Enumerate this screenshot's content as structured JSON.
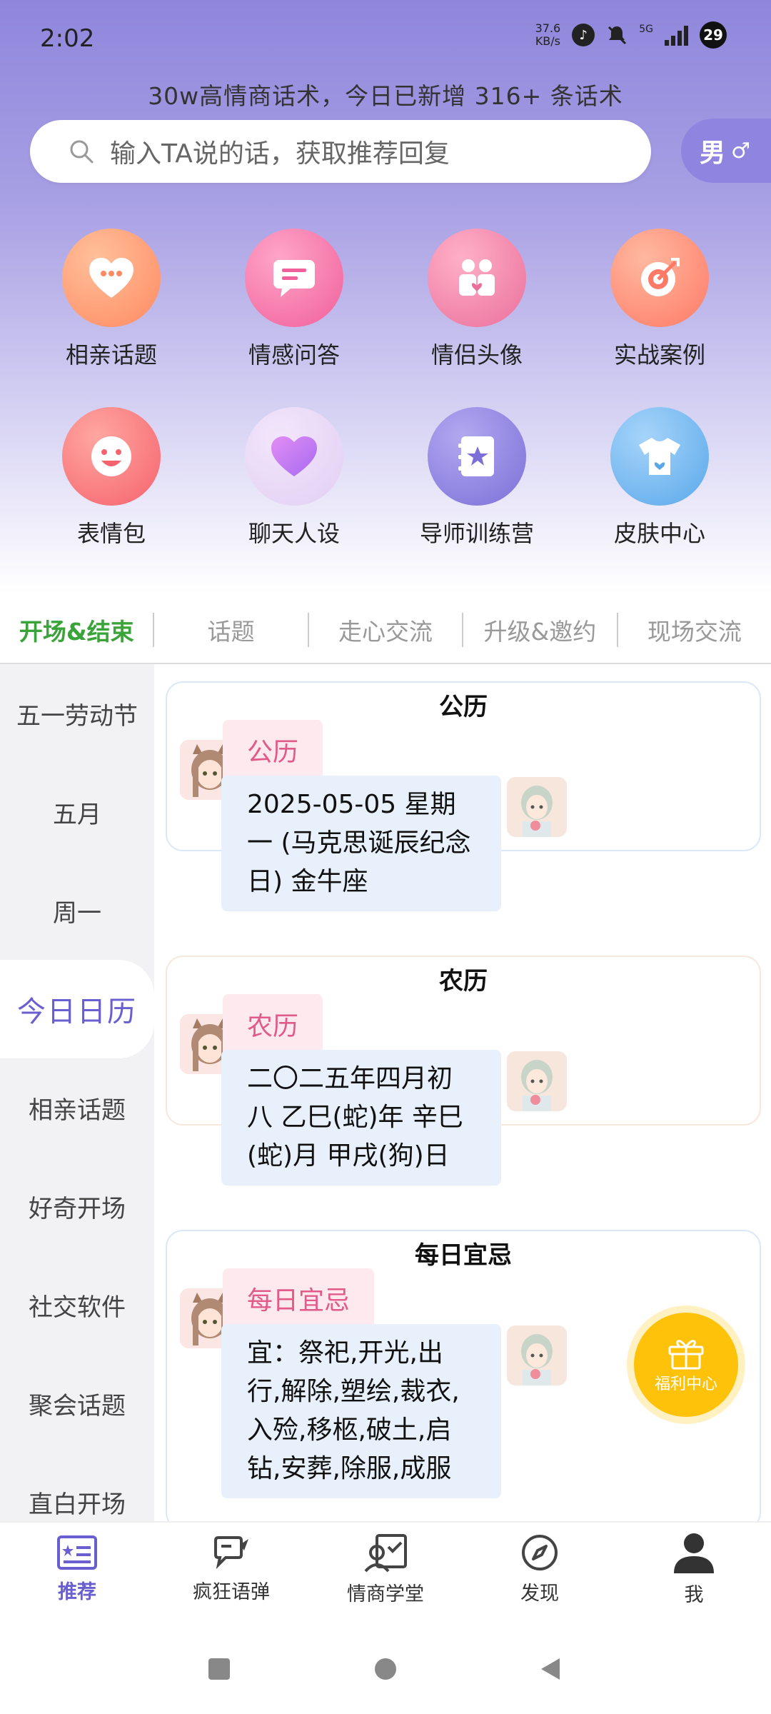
{
  "status": {
    "time": "2:02",
    "speed_top": "37.6",
    "speed_bottom": "KB/s",
    "network": "5G",
    "battery": "29"
  },
  "banner": "30w高情商话术，今日已新增 316+ 条话术",
  "search": {
    "placeholder": "输入TA说的话，获取推荐回复"
  },
  "gender": {
    "label": "男",
    "symbol": "♂"
  },
  "features": [
    {
      "label": "相亲话题",
      "icon": "heart-chat-icon",
      "color": "#ff9a72"
    },
    {
      "label": "情感问答",
      "icon": "message-icon",
      "color": "#f77ba8"
    },
    {
      "label": "情侣头像",
      "icon": "couple-icon",
      "color": "#f08aae"
    },
    {
      "label": "实战案例",
      "icon": "target-icon",
      "color": "#ff8d78"
    },
    {
      "label": "表情包",
      "icon": "smile-icon",
      "color": "#ff7f86"
    },
    {
      "label": "聊天人设",
      "icon": "heart-icon",
      "color": "#e8d6f7"
    },
    {
      "label": "导师训练营",
      "icon": "book-star-icon",
      "color": "#8e83e0"
    },
    {
      "label": "皮肤中心",
      "icon": "tshirt-icon",
      "color": "#74b8f0"
    }
  ],
  "tabs": [
    "开场&结束",
    "话题",
    "走心交流",
    "升级&邀约",
    "现场交流"
  ],
  "sidebar": [
    "五一劳动节",
    "五月",
    "周一",
    "今日日历",
    "相亲话题",
    "好奇开场",
    "社交软件",
    "聚会话题",
    "直白开场"
  ],
  "cards": [
    {
      "title": "公历",
      "tag": "公历",
      "text": "2025-05-05 星期一 (马克思诞辰纪念日) 金牛座"
    },
    {
      "title": "农历",
      "tag": "农历",
      "text": "二〇二五年四月初八 乙巳(蛇)年 辛巳(蛇)月 甲戌(狗)日"
    },
    {
      "title": "每日宜忌",
      "tag": "每日宜忌",
      "text": "宜：祭祀,开光,出行,解除,塑绘,裁衣,入殓,移柩,破土,启钻,安葬,除服,成服"
    }
  ],
  "fab": {
    "label": "福利中心"
  },
  "bottom_nav": [
    "推荐",
    "疯狂语弹",
    "情商学堂",
    "发现",
    "我"
  ],
  "colors": {
    "accent": "#6a5fd0",
    "active_tab": "#3aa33a",
    "tag_text": "#e25a8a",
    "fab": "#ffc20a"
  }
}
